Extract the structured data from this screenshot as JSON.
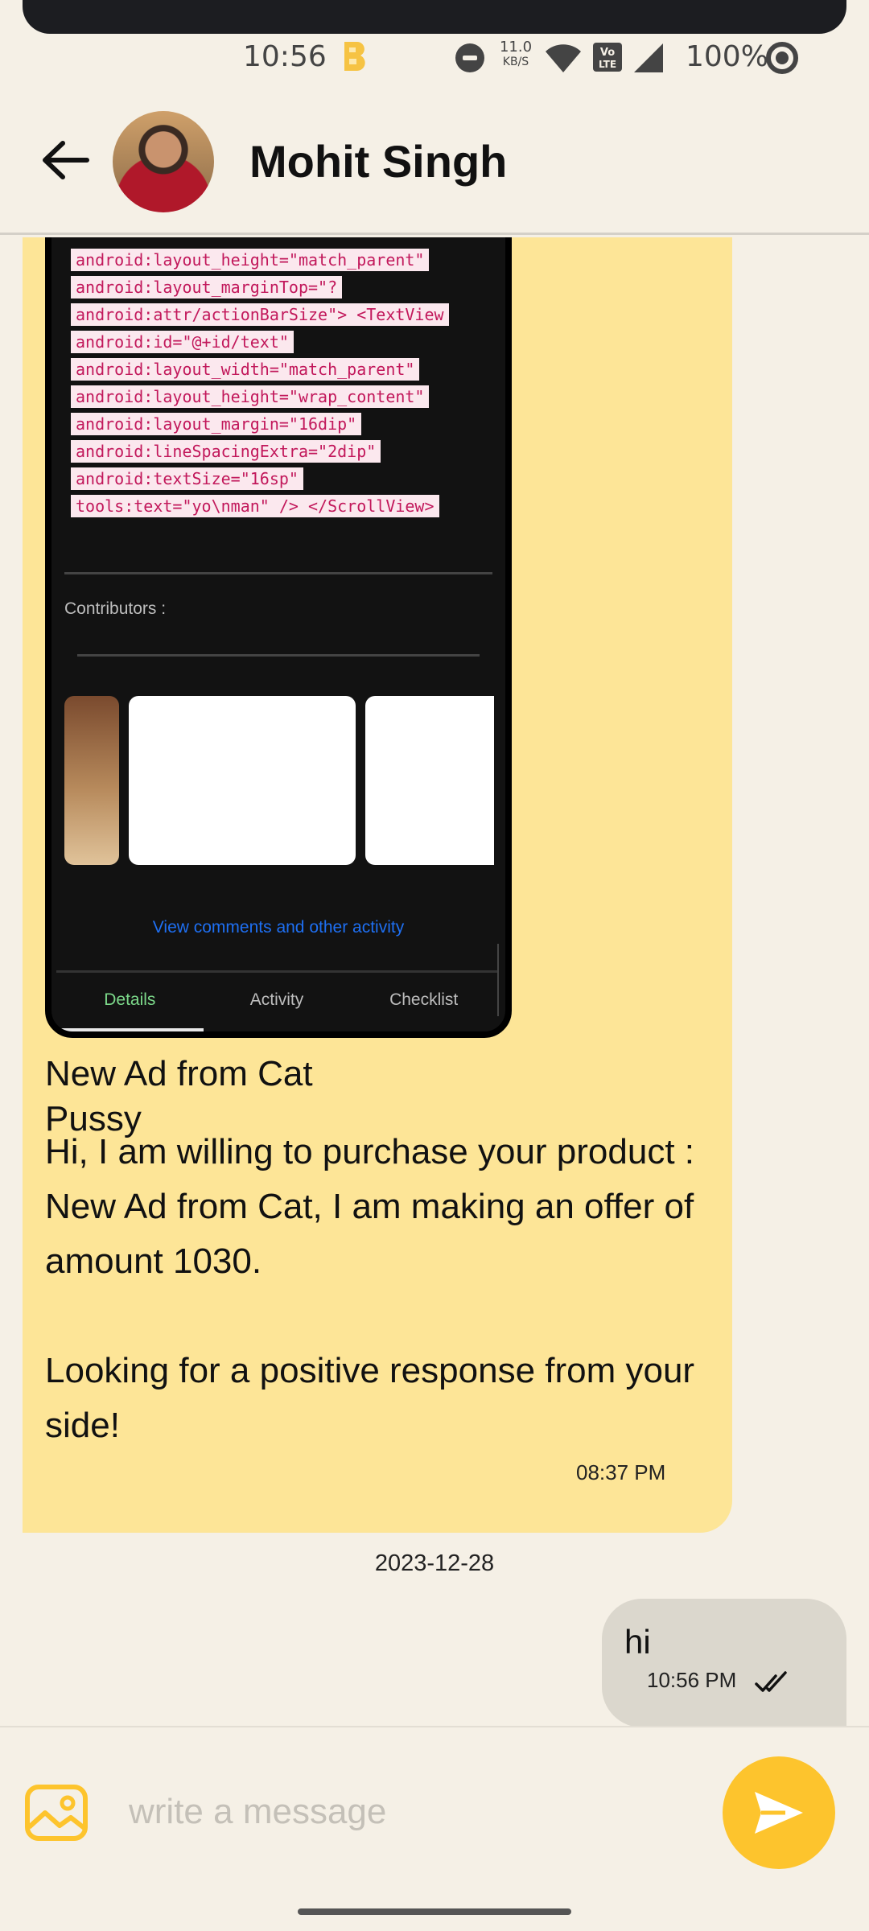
{
  "status_bar": {
    "time": "10:56",
    "net_speed_value": "11.0",
    "net_speed_unit": "KB/S",
    "battery": "100%"
  },
  "header": {
    "contact_name": "Mohit Singh"
  },
  "messages": {
    "incoming": {
      "screenshot": {
        "code_lines": [
          "android:layout_height=\"match_parent\"",
          "android:layout_marginTop=\"?",
          "android:attr/actionBarSize\"> <TextView",
          "android:id=\"@+id/text\"",
          "android:layout_width=\"match_parent\"",
          "android:layout_height=\"wrap_content\"",
          "android:layout_margin=\"16dip\"",
          "android:lineSpacingExtra=\"2dip\"",
          "android:textSize=\"16sp\"",
          "tools:text=\"yo\\nman\" /> </ScrollView>"
        ],
        "contributors_label": "Contributors :",
        "view_comments": "View comments and other activity",
        "tabs": [
          "Details",
          "Activity",
          "Checklist"
        ]
      },
      "title": "New Ad from Cat\nPussy",
      "body": "Hi, I am willing to purchase your product : New Ad from Cat, I am making an offer of amount 1030.\n\nLooking for a positive response from your side!",
      "time": "08:37 PM"
    },
    "date_separator": "2023-12-28",
    "outgoing": {
      "text": "hi",
      "time": "10:56 PM"
    }
  },
  "composer": {
    "placeholder": "write a message"
  },
  "colors": {
    "incoming_bubble": "#fde597",
    "outgoing_bubble": "#dbd7cd",
    "send_button": "#fdc42d",
    "background": "#f5f0e6"
  }
}
